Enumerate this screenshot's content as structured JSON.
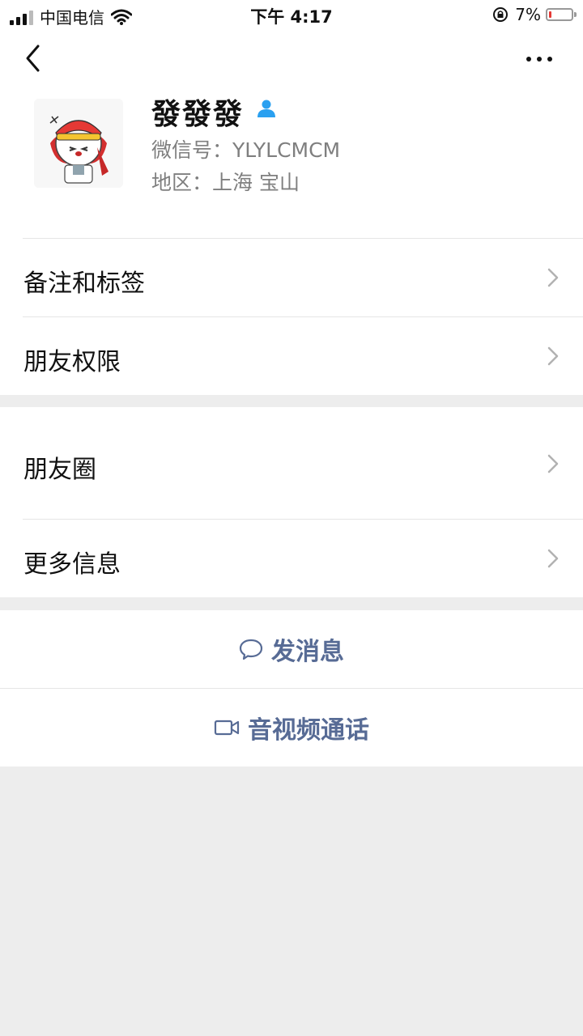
{
  "status_bar": {
    "carrier": "中国电信",
    "time": "下午 4:17",
    "battery_percent": "7%",
    "battery_level": 0.07
  },
  "nav": {
    "back_icon": "chevron-left-icon",
    "more_icon": "more-dots-icon"
  },
  "profile": {
    "name": "發發發",
    "wechat_id": "微信号：YLYLCMCM",
    "region": "地区：上海 宝山",
    "badge_icon": "person-icon",
    "badge_color": "#2aa0f0"
  },
  "group1": [
    {
      "label": "备注和标签"
    },
    {
      "label": "朋友权限"
    }
  ],
  "group2": [
    {
      "label": "朋友圈"
    },
    {
      "label": "更多信息"
    }
  ],
  "actions": {
    "message": {
      "label": "发消息",
      "icon": "chat-bubble-icon"
    },
    "call": {
      "label": "音视频通话",
      "icon": "video-camera-icon"
    },
    "link_color": "#576b95"
  }
}
